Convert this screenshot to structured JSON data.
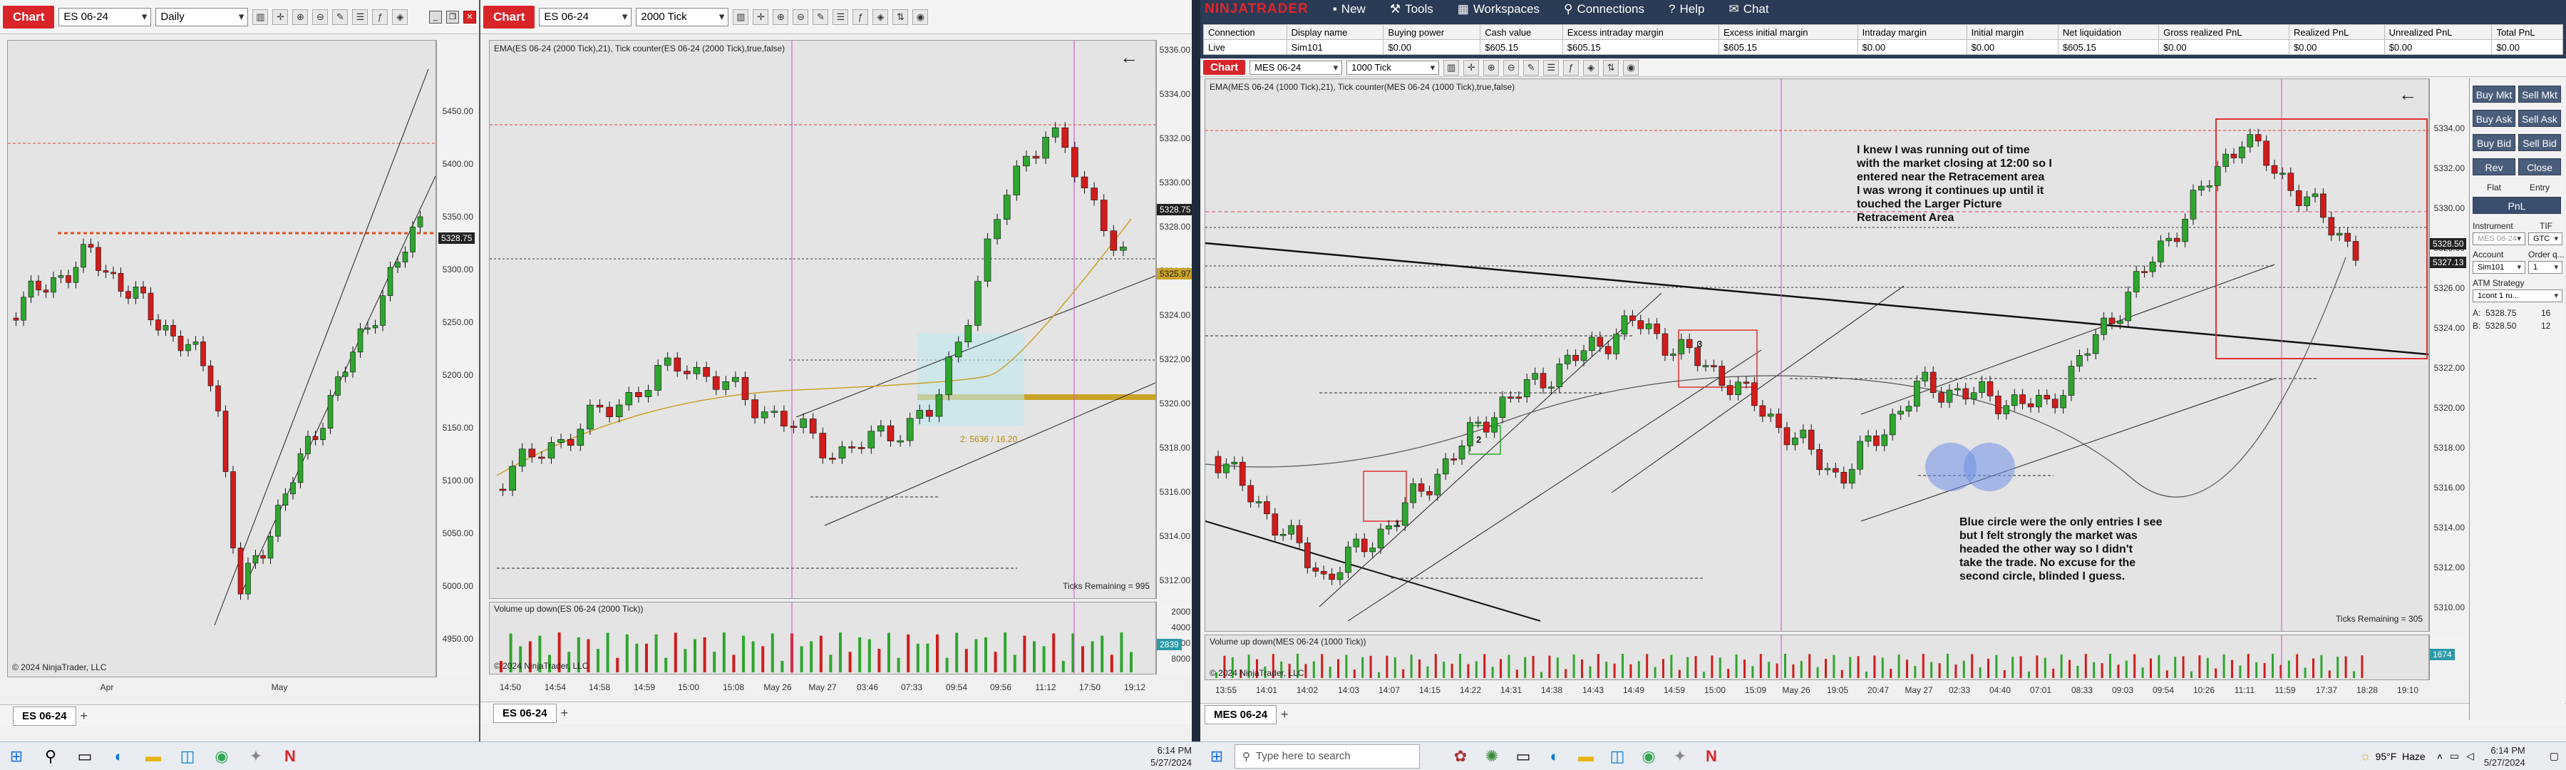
{
  "left_window": {
    "chart_tag": "Chart",
    "instrument": "ES 06-24",
    "interval": "Daily",
    "y_labels": [
      "5450.00",
      "5400.00",
      "5350.00",
      "5300.00",
      "5250.00",
      "5200.00",
      "5150.00",
      "5100.00",
      "5050.00",
      "5000.00",
      "4950.00"
    ],
    "price_badge": "5328.75",
    "x_labels": [
      "Apr",
      "May"
    ],
    "copyright": "© 2024 NinjaTrader, LLC",
    "tab": "ES 06-24"
  },
  "middle_window": {
    "chart_tag": "Chart",
    "instrument": "ES 06-24",
    "interval": "2000 Tick",
    "indicator_label": "EMA(ES 06-24 (2000 Tick),21), Tick counter(ES 06-24 (2000 Tick),true,false)",
    "y_labels": [
      "5336.00",
      "5334.00",
      "5332.00",
      "5330.00",
      "5328.00",
      "5326.00",
      "5324.00",
      "5322.00",
      "5320.00",
      "5318.00",
      "5316.00",
      "5314.00",
      "5312.00"
    ],
    "price_badge": "5328.75",
    "ema_badge": "5325.97",
    "ticks_remaining": "Ticks Remaining = 995",
    "volume_label": "Volume up down(ES 06-24 (2000 Tick))",
    "volume_y_labels": [
      "8000",
      "6000",
      "4000",
      "2000"
    ],
    "volume_badge": "2839",
    "retracement_label": "2: 5636 / 16.20",
    "x_labels": [
      "14:50",
      "14:54",
      "14:58",
      "14:59",
      "15:00",
      "15:08",
      "May 26",
      "May 27",
      "03:46",
      "07:33",
      "09:54",
      "09:56",
      "11:12",
      "17:50",
      "19:12"
    ],
    "copyright": "© 2024 NinjaTrader, LLC",
    "tab": "ES 06-24"
  },
  "control_center": {
    "brand": "NINJATRADER",
    "menu": [
      {
        "icon": "new-icon",
        "label": "New"
      },
      {
        "icon": "tools-icon",
        "label": "Tools"
      },
      {
        "icon": "workspaces-icon",
        "label": "Workspaces"
      },
      {
        "icon": "connections-icon",
        "label": "Connections"
      },
      {
        "icon": "help-icon",
        "label": "Help"
      },
      {
        "icon": "chat-icon",
        "label": "Chat"
      }
    ],
    "columns": [
      "Connection",
      "Display name",
      "Buying power",
      "Cash value",
      "Excess intraday margin",
      "Excess initial margin",
      "Intraday margin",
      "Initial margin",
      "Net liquidation",
      "Gross realized PnL",
      "Realized PnL",
      "Unrealized PnL",
      "Total PnL"
    ],
    "row": [
      "Live",
      "Sim101",
      "$0.00",
      "$605.15",
      "$605.15",
      "$605.15",
      "$0.00",
      "$0.00",
      "$605.15",
      "$0.00",
      "$0.00",
      "$0.00",
      "$0.00"
    ]
  },
  "right_window": {
    "chart_tag": "Chart",
    "instrument": "MES 06-24",
    "interval": "1000 Tick",
    "indicator_label": "EMA(MES 06-24 (1000 Tick),21), Tick counter(MES 06-24 (1000 Tick),true,false)",
    "y_labels": [
      "5334.00",
      "5332.00",
      "5330.00",
      "5328.00",
      "5326.00",
      "5324.00",
      "5322.00",
      "5320.00",
      "5318.00",
      "5316.00",
      "5314.00",
      "5312.00",
      "5310.00"
    ],
    "price_badge": "5328.50",
    "ema_badge": "5327.13",
    "ticks_remaining": "Ticks Remaining = 305",
    "volume_label": "Volume up down(MES 06-24 (1000 Tick))",
    "volume_badge": "1674",
    "note_top": "I knew I was running out of time\nwith the market closing at 12:00 so I\nentered near the Retracement area\nI was wrong it continues up until it\ntouched the Larger Picture\nRetracement Area",
    "note_bottom": "Blue circle were the only entries I see\nbut I felt strongly the market was\nheaded the other way so I didn't\ntake the trade. No excuse for the\nsecond circle, blinded I guess.",
    "box_labels": [
      "1",
      "2",
      "3"
    ],
    "x_labels": [
      "13:55",
      "14:01",
      "14:02",
      "14:03",
      "14:07",
      "14:15",
      "14:22",
      "14:31",
      "14:38",
      "14:43",
      "14:49",
      "14:59",
      "15:00",
      "15:09",
      "May 26",
      "19:05",
      "20:47",
      "May 27",
      "02:33",
      "04:40",
      "07:01",
      "08:33",
      "09:03",
      "09:54",
      "10:26",
      "11:11",
      "11:59",
      "17:37",
      "18:28",
      "19:10"
    ],
    "copyright": "© 2024 NinjaTrader, LLC",
    "tab": "MES 06-24"
  },
  "chart_trader": {
    "buy_mkt": "Buy Mkt",
    "sell_mkt": "Sell Mkt",
    "buy_ask": "Buy Ask",
    "sell_ask": "Sell Ask",
    "buy_bid": "Buy Bid",
    "sell_bid": "Sell Bid",
    "rev": "Rev",
    "close": "Close",
    "flat": "Flat",
    "entry": "Entry",
    "pnl": "PnL",
    "instrument_label": "Instrument",
    "tif_label": "TIF",
    "instrument_value": "MES 06-24",
    "tif_value": "GTC",
    "account_label": "Account",
    "order_qty_label": "Order q...",
    "account_value": "Sim101",
    "qty_value": "1",
    "atm_label": "ATM Strategy",
    "atm_value": "1cont 1 ru...",
    "ask_label": "A:",
    "ask_price": "5328.75",
    "ask_size": "16",
    "bid_label": "B:",
    "bid_price": "5328.50",
    "bid_size": "12"
  },
  "taskbar_left": {
    "time": "6:14 PM",
    "date": "5/27/2024"
  },
  "taskbar_right": {
    "search_placeholder": "Type here to search",
    "weather": "95°F  Haze",
    "time": "6:14 PM",
    "date": "5/27/2024"
  },
  "chart_data": [
    {
      "type": "candlestick",
      "instrument": "ES 06-24",
      "interval": "Daily",
      "ylim": [
        4950,
        5450
      ],
      "x_ticks": [
        "Apr",
        "May"
      ],
      "last": 5328.75
    },
    {
      "type": "candlestick",
      "instrument": "ES 06-24",
      "interval": "2000 Tick",
      "ylim": [
        5312,
        5336
      ],
      "last": 5328.75,
      "ema21": 5325.97,
      "volume_ticks": [
        2000,
        4000,
        6000,
        8000
      ]
    },
    {
      "type": "candlestick",
      "instrument": "MES 06-24",
      "interval": "1000 Tick",
      "ylim": [
        5310,
        5334
      ],
      "last": 5328.5,
      "ema21": 5327.13
    }
  ]
}
